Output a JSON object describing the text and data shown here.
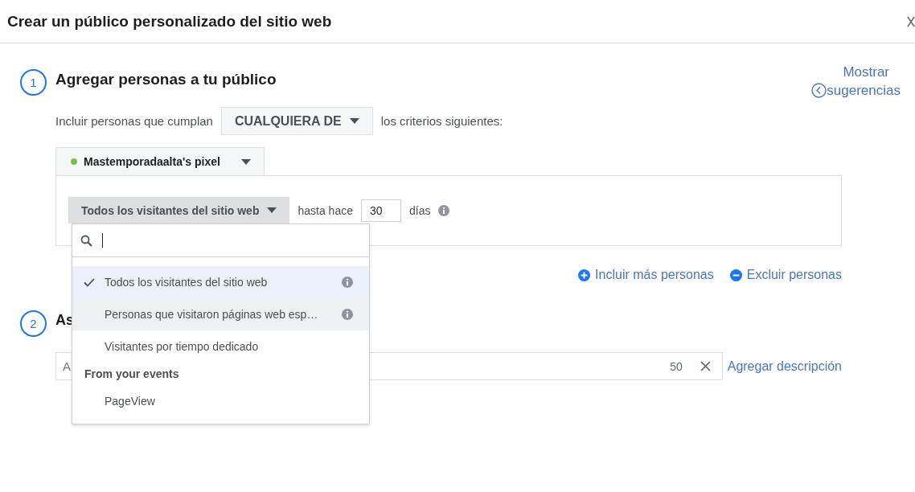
{
  "dialog": {
    "title": "Crear un público personalizado del sitio web",
    "suggestions_link": {
      "line_1": "Mostrar",
      "line_2": "sugerencias"
    }
  },
  "step_1": {
    "number": "1",
    "title": "Agregar personas a tu público",
    "rule_prefix": "Incluir personas que cumplan",
    "rule_dropdown": "CUALQUIERA DE",
    "rule_suffix": "los criterios siguientes:",
    "pixel": {
      "name": "Mastemporadaalta's pixel",
      "color": "#7cbf45"
    },
    "source_dropdown": "Todos los visitantes del sitio web",
    "days_prefix": "hasta hace",
    "days_value": "30",
    "days_suffix": "días",
    "include_link": "Incluir más personas",
    "exclude_link": "Excluir personas"
  },
  "menu": {
    "items": [
      {
        "kind": "option",
        "label": "Todos los visitantes del sitio web",
        "selected": true,
        "highlighted": false,
        "info": true
      },
      {
        "kind": "option",
        "label": "Personas que visitaron páginas web esp…",
        "selected": false,
        "highlighted": true,
        "info": true
      },
      {
        "kind": "option",
        "label": "Visitantes por tiempo dedicado",
        "selected": false,
        "highlighted": false,
        "info": false
      },
      {
        "kind": "heading",
        "label": "From your events"
      },
      {
        "kind": "option",
        "label": "PageView",
        "selected": false,
        "highlighted": false,
        "info": false
      }
    ]
  },
  "step_2": {
    "number": "2",
    "title": "As",
    "name_field": {
      "placeholder": "A",
      "counter": "50"
    },
    "description_link": "Agregar descripción"
  }
}
